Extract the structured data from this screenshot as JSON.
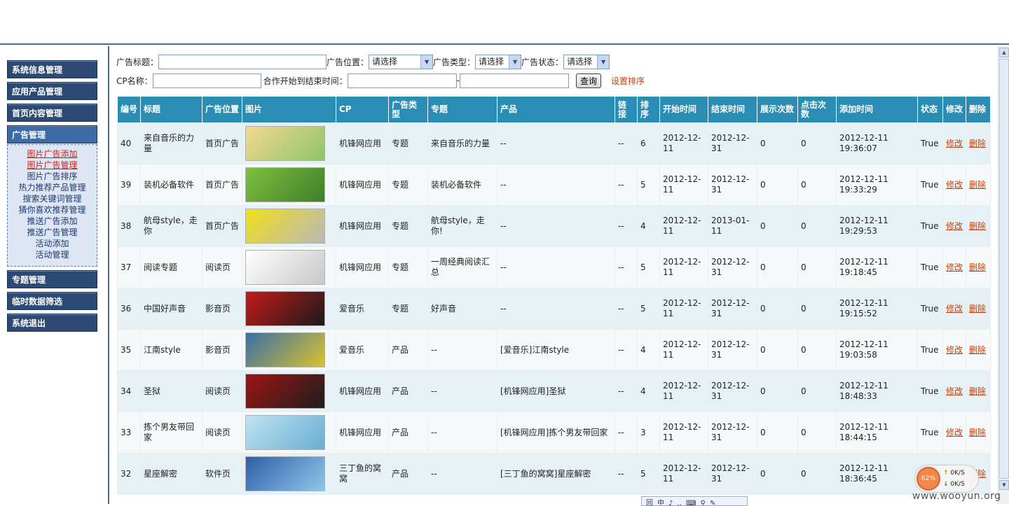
{
  "sidebar": {
    "menu": [
      "系统信息管理",
      "应用产品管理",
      "首页内容管理",
      "广告管理",
      "专题管理",
      "临时数据筛选",
      "系统退出"
    ],
    "submenu": [
      "图片广告添加",
      "图片广告管理",
      "图片广告排序",
      "热力推荐产品管理",
      "搜索关键词管理",
      "猜你喜欢推荐管理",
      "推送广告添加",
      "推送广告管理",
      "活动添加",
      "活动管理"
    ]
  },
  "filter": {
    "title_label": "广告标题：",
    "position_label": "广告位置：",
    "position_value": "请选择",
    "type_label": "广告类型：",
    "type_value": "请选择",
    "status_label": "广告状态：",
    "status_value": "请选择",
    "cp_label": "CP名称：",
    "date_label": "合作开始到结束时间：",
    "date_sep": "-",
    "query_btn": "查询",
    "sort_link": "设置排序"
  },
  "table": {
    "headers": [
      "编号",
      "标题",
      "广告位置",
      "图片",
      "CP",
      "广告类型",
      "专题",
      "产品",
      "链接",
      "排序",
      "开始时间",
      "结束时间",
      "展示次数",
      "点击次数",
      "添加时间",
      "状态",
      "修改",
      "删除"
    ],
    "edit_label": "修改",
    "delete_label": "删除",
    "rows": [
      {
        "id": "40",
        "title": "来自音乐的力量",
        "pos": "首页广告",
        "cp": "机锋网应用",
        "type": "专题",
        "topic": "来自音乐的力量",
        "product": "--",
        "link": "--",
        "sort": "6",
        "start": "2012-12-11",
        "end": "2012-12-31",
        "views": "0",
        "clicks": "0",
        "added": "2012-12-11 19:36:07",
        "status": "True",
        "img_colors": [
          "#f3d98f",
          "#8fc46a"
        ]
      },
      {
        "id": "39",
        "title": "装机必备软件",
        "pos": "首页广告",
        "cp": "机锋网应用",
        "type": "专题",
        "topic": "装机必备软件",
        "product": "--",
        "link": "--",
        "sort": "5",
        "start": "2012-12-11",
        "end": "2012-12-31",
        "views": "0",
        "clicks": "0",
        "added": "2012-12-11 19:33:29",
        "status": "True",
        "img_colors": [
          "#7fbf3f",
          "#3f7f2a"
        ]
      },
      {
        "id": "38",
        "title": "航母style，走你",
        "pos": "首页广告",
        "cp": "机锋网应用",
        "type": "专题",
        "topic": "航母style，走你!",
        "product": "--",
        "link": "--",
        "sort": "4",
        "start": "2012-12-11",
        "end": "2013-01-11",
        "views": "0",
        "clicks": "0",
        "added": "2012-12-11 19:29:53",
        "status": "True",
        "img_colors": [
          "#f2e01a",
          "#b8b8b8"
        ]
      },
      {
        "id": "37",
        "title": "阅读专题",
        "pos": "阅读页",
        "cp": "机锋网应用",
        "type": "专题",
        "topic": "一周经典阅读汇总",
        "product": "--",
        "link": "--",
        "sort": "5",
        "start": "2012-12-11",
        "end": "2012-12-31",
        "views": "0",
        "clicks": "0",
        "added": "2012-12-11 19:18:45",
        "status": "True",
        "img_colors": [
          "#ffffff",
          "#c8c8c8"
        ]
      },
      {
        "id": "36",
        "title": "中国好声音",
        "pos": "影音页",
        "cp": "爱音乐",
        "type": "专题",
        "topic": "好声音",
        "product": "--",
        "link": "--",
        "sort": "5",
        "start": "2012-12-11",
        "end": "2012-12-31",
        "views": "0",
        "clicks": "0",
        "added": "2012-12-11 19:15:52",
        "status": "True",
        "img_colors": [
          "#c41a1a",
          "#1a1a1a"
        ]
      },
      {
        "id": "35",
        "title": "江南style",
        "pos": "影音页",
        "cp": "爱音乐",
        "type": "产品",
        "topic": "--",
        "product": "[爱音乐]江南style",
        "link": "--",
        "sort": "4",
        "start": "2012-12-11",
        "end": "2012-12-31",
        "views": "0",
        "clicks": "0",
        "added": "2012-12-11 19:03:58",
        "status": "True",
        "img_colors": [
          "#3a6ea5",
          "#d8c230"
        ]
      },
      {
        "id": "34",
        "title": "圣狱",
        "pos": "阅读页",
        "cp": "机锋网应用",
        "type": "产品",
        "topic": "--",
        "product": "[机锋网应用]圣狱",
        "link": "--",
        "sort": "4",
        "start": "2012-12-11",
        "end": "2012-12-31",
        "views": "0",
        "clicks": "0",
        "added": "2012-12-11 18:48:33",
        "status": "True",
        "img_colors": [
          "#9e1414",
          "#1e1e1e"
        ]
      },
      {
        "id": "33",
        "title": "拣个男友带回家",
        "pos": "阅读页",
        "cp": "机锋网应用",
        "type": "产品",
        "topic": "--",
        "product": "[机锋网应用]拣个男友带回家",
        "link": "--",
        "sort": "3",
        "start": "2012-12-11",
        "end": "2012-12-31",
        "views": "0",
        "clicks": "0",
        "added": "2012-12-11 18:44:15",
        "status": "True",
        "img_colors": [
          "#bfe3f2",
          "#6aaed0"
        ]
      },
      {
        "id": "32",
        "title": "星座解密",
        "pos": "软件页",
        "cp": "三丁鱼的窝窝",
        "type": "产品",
        "topic": "--",
        "product": "[三丁鱼的窝窝]星座解密",
        "link": "--",
        "sort": "5",
        "start": "2012-12-11",
        "end": "2012-12-31",
        "views": "0",
        "clicks": "0",
        "added": "2012-12-11 18:36:45",
        "status": "True",
        "img_colors": [
          "#2f5fa8",
          "#8ec6e6"
        ]
      }
    ]
  },
  "speed": {
    "percent": "62%",
    "up": "0K/S",
    "down": "0K/S"
  },
  "ime_text": "回中♪‥⌨⚲✎",
  "watermark": "www.wooyun.org"
}
